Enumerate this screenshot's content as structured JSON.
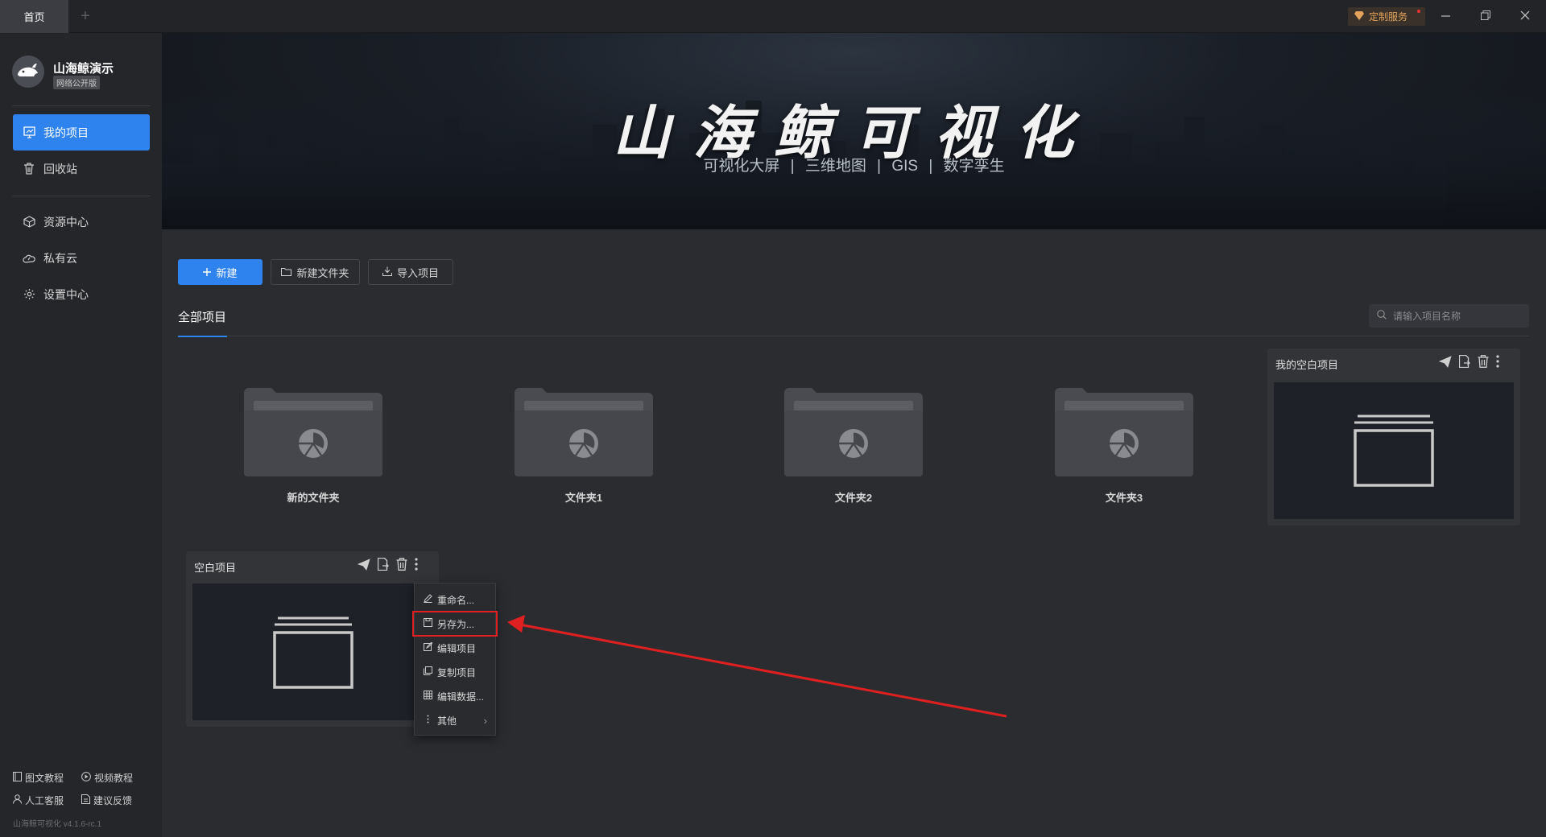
{
  "titlebar": {
    "home_tab": "首页",
    "add_tab": "+",
    "service_label": "定制服务",
    "icons": [
      "gem-icon",
      "minimize-icon",
      "restore-icon",
      "close-icon"
    ]
  },
  "sidebar": {
    "brand_name": "山海鲸演示",
    "brand_badge": "网络公开版",
    "items": [
      {
        "label": "我的项目",
        "icon": "project-icon",
        "active": true
      },
      {
        "label": "回收站",
        "icon": "trash-icon",
        "active": false
      },
      {
        "label": "资源中心",
        "icon": "cube-icon",
        "active": false
      },
      {
        "label": "私有云",
        "icon": "cloud-icon",
        "active": false
      },
      {
        "label": "设置中心",
        "icon": "gear-icon",
        "active": false
      }
    ],
    "footer": {
      "tutorial_text": "图文教程",
      "tutorial_video": "视频教程",
      "customer_service": "人工客服",
      "feedback": "建议反馈",
      "version": "山海鲸可视化 v4.1.6-rc.1"
    }
  },
  "banner": {
    "title": "山海鲸可视化",
    "subtitle": "可视化大屏  |  三维地图  |  GIS  |  数字孪生"
  },
  "toolbar": {
    "new_label": "新建",
    "new_folder_label": "新建文件夹",
    "import_label": "导入项目"
  },
  "tabs": {
    "all_projects": "全部项目"
  },
  "search": {
    "placeholder": "请输入项目名称",
    "value": ""
  },
  "folders": [
    {
      "name": "新的文件夹"
    },
    {
      "name": "文件夹1"
    },
    {
      "name": "文件夹2"
    },
    {
      "name": "文件夹3"
    }
  ],
  "projects": [
    {
      "name": "我的空白项目"
    },
    {
      "name": "空白项目"
    }
  ],
  "context_menu": {
    "items": [
      {
        "label": "重命名...",
        "icon": "edit-icon"
      },
      {
        "label": "另存为...",
        "icon": "save-icon",
        "highlighted": true
      },
      {
        "label": "编辑项目",
        "icon": "edit-project-icon"
      },
      {
        "label": "复制项目",
        "icon": "copy-icon"
      },
      {
        "label": "编辑数据...",
        "icon": "table-icon"
      },
      {
        "label": "其他",
        "icon": "more-icon",
        "submenu": true
      }
    ]
  },
  "colors": {
    "accent": "#2f83ee",
    "background": "#2b2c30",
    "sidebar": "#25262a",
    "annotation": "#e02020",
    "service": "#e2a25a"
  }
}
